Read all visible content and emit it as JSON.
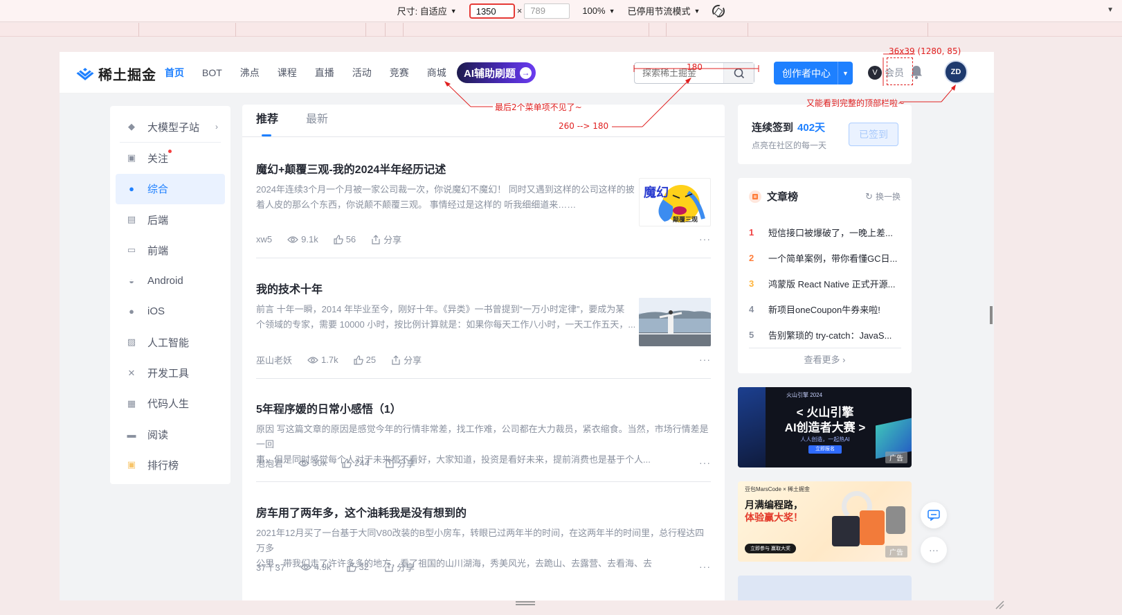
{
  "devtools": {
    "size_label": "尺寸: 自适应",
    "width_value": "1350",
    "times": "×",
    "height_value": "789",
    "zoom": "100%",
    "throttle": "已停用节流模式"
  },
  "header": {
    "logo_text": "稀土掘金",
    "nav": [
      "首页",
      "BOT",
      "沸点",
      "课程",
      "直播",
      "活动",
      "竞赛",
      "商城"
    ],
    "ai_button": "AI辅助刷题",
    "search_placeholder": "探索稀土掘金",
    "creator_button": "创作者中心",
    "vip_label": "会员",
    "avatar_text": "ZD"
  },
  "sidebar": {
    "items": [
      {
        "label": "大模型子站",
        "icon": "cube-icon"
      },
      {
        "label": "关注",
        "icon": "follow-icon"
      },
      {
        "label": "综合",
        "icon": "compass-icon"
      },
      {
        "label": "后端",
        "icon": "backend-icon"
      },
      {
        "label": "前端",
        "icon": "frontend-icon"
      },
      {
        "label": "Android",
        "icon": "android-icon"
      },
      {
        "label": "iOS",
        "icon": "apple-icon"
      },
      {
        "label": "人工智能",
        "icon": "robot-icon"
      },
      {
        "label": "开发工具",
        "icon": "tools-icon"
      },
      {
        "label": "代码人生",
        "icon": "code-life-icon"
      },
      {
        "label": "阅读",
        "icon": "reading-icon"
      },
      {
        "label": "排行榜",
        "icon": "ranking-icon"
      }
    ]
  },
  "feed": {
    "tabs": [
      "推荐",
      "最新"
    ],
    "articles": [
      {
        "title": "魔幻+颠覆三观-我的2024半年经历记述",
        "abstract_line1": "2024年连续3个月一个月被一家公司裁一次，你说魔幻不魔幻！ 同时又遇到这样的公司这样的披",
        "abstract_line2": "着人皮的那么个东西，你说颠不颠覆三观。 事情经过是这样的 听我细细道来……",
        "author": "xw5",
        "views": "9.1k",
        "likes": "56",
        "share": "分享",
        "thumb_text": "魔幻",
        "thumb_sub": "颠覆三观"
      },
      {
        "title": "我的技术十年",
        "abstract_line1": "前言 十年一瞬，2014 年毕业至今，刚好十年。《异类》一书曾提到“一万小时定律”，要成为某",
        "abstract_line2": "个领域的专家，需要 10000 小时，按比例计算就是：如果你每天工作八小时，一天工作五天，...",
        "author": "巫山老妖",
        "views": "1.7k",
        "likes": "25",
        "share": "分享"
      },
      {
        "title": "5年程序媛的日常小感悟（1）",
        "abstract_line1": "原因 写这篇文章的原因是感觉今年的行情非常差，找工作难，公司都在大力裁员，紧衣缩食。当然，市场行情差是一回",
        "abstract_line2": "事，但是同时感觉每个人对于未来都不看好，大家知道，投资是看好未来，提前消费也是基于个人...",
        "author": "泡泡君",
        "views": "30k",
        "likes": "244",
        "share": "分享"
      },
      {
        "title": "房车用了两年多，这个油耗我是没有想到的",
        "abstract_line1": "2021年12月买了一台基于大同V80改装的B型小房车，转眼已过两年半的时间，在这两年半的时间里，总行程达四万多",
        "abstract_line2": "公里，带我们走了许许多多的地方，看了祖国的山川湖海，秀美风光，去跪山、去露营、去看海、去",
        "author": "37丫37",
        "views": "4.9k",
        "likes": "32",
        "share": "分享"
      }
    ]
  },
  "signin": {
    "title": "连续签到",
    "days": "402天",
    "subtitle": "点亮在社区的每一天",
    "button": "已签到"
  },
  "rank": {
    "title": "文章榜",
    "swap": "换一换",
    "items": [
      {
        "n": "1",
        "title": "短信接口被爆破了，一晚上差..."
      },
      {
        "n": "2",
        "title": "一个简单案例，带你看懂GC日..."
      },
      {
        "n": "3",
        "title": "鸿蒙版 React Native 正式开源..."
      },
      {
        "n": "4",
        "title": "新项目oneCoupon牛券来啦!"
      },
      {
        "n": "5",
        "title": "告别繁琐的 try-catch：JavaS..."
      }
    ],
    "more": "查看更多"
  },
  "ads": {
    "ad1_brand": "火山引擎 2024",
    "ad1_line1": "< 火山引擎",
    "ad1_line2": "AI创造者大赛 >",
    "ad1_sub": "人人创造，一起热AI",
    "ad1_cta": "立即报名",
    "ad2_brand": "豆包MarsCode × 稀土掘金",
    "ad2_line1": "月满编程路，",
    "ad2_line2": "体验赢大奖！",
    "ad2_cta": "立即参与 赢取大奖",
    "tag": "广告"
  },
  "annotations": {
    "size_note": "36x39 (1280, 85)",
    "menu_note": "最后2个菜单项不见了~",
    "search_width": "180",
    "search_change": "260 --> 180",
    "topbar_note": "又能看到完整的顶部栏啦~"
  },
  "colors": {
    "brand_blue": "#1e80ff",
    "annotation_red": "#e02020"
  }
}
